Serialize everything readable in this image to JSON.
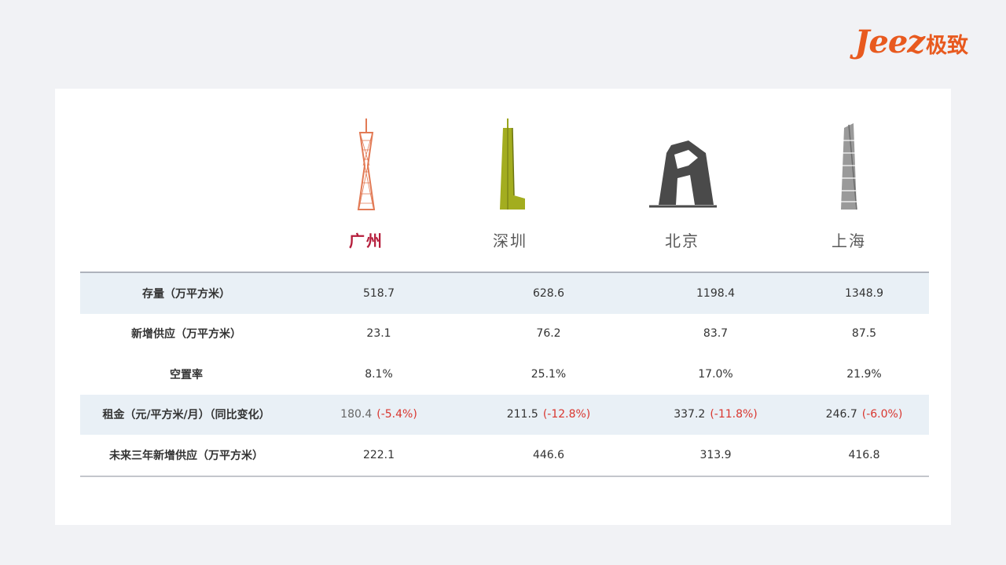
{
  "logo": {
    "latin": "Jeez",
    "cn": "极致",
    "color": "#e85a1f"
  },
  "chart_data": {
    "type": "table",
    "columns": [
      "广州",
      "深圳",
      "北京",
      "上海"
    ],
    "highlight_column": "广州",
    "rows": [
      {
        "label": "存量（万平方米）",
        "values": [
          "518.7",
          "628.6",
          "1198.4",
          "1348.9"
        ],
        "shaded": true
      },
      {
        "label": "新增供应（万平方米）",
        "values": [
          "23.1",
          "76.2",
          "83.7",
          "87.5"
        ],
        "shaded": false
      },
      {
        "label": "空置率",
        "values": [
          "8.1%",
          "25.1%",
          "17.0%",
          "21.9%"
        ],
        "shaded": false
      },
      {
        "label": "租金（元/平方米/月）（同比变化）",
        "values": [
          "180.4",
          "211.5",
          "337.2",
          "246.7"
        ],
        "changes": [
          "(-5.4%)",
          "(-12.8%)",
          "(-11.8%)",
          "(-6.0%)"
        ],
        "shaded": true
      },
      {
        "label": "未来三年新增供应（万平方米）",
        "values": [
          "222.1",
          "446.6",
          "313.9",
          "416.8"
        ],
        "shaded": false
      }
    ],
    "colors": {
      "highlight_city": "#b51d3b",
      "change_text": "#d9362f",
      "shaded_row": "#e9f0f6",
      "canton_tower": "#e27a55",
      "ping_an_tower": "#9aa51c",
      "cctv_building": "#444444",
      "shanghai_tower": "#8a8a8a"
    }
  }
}
